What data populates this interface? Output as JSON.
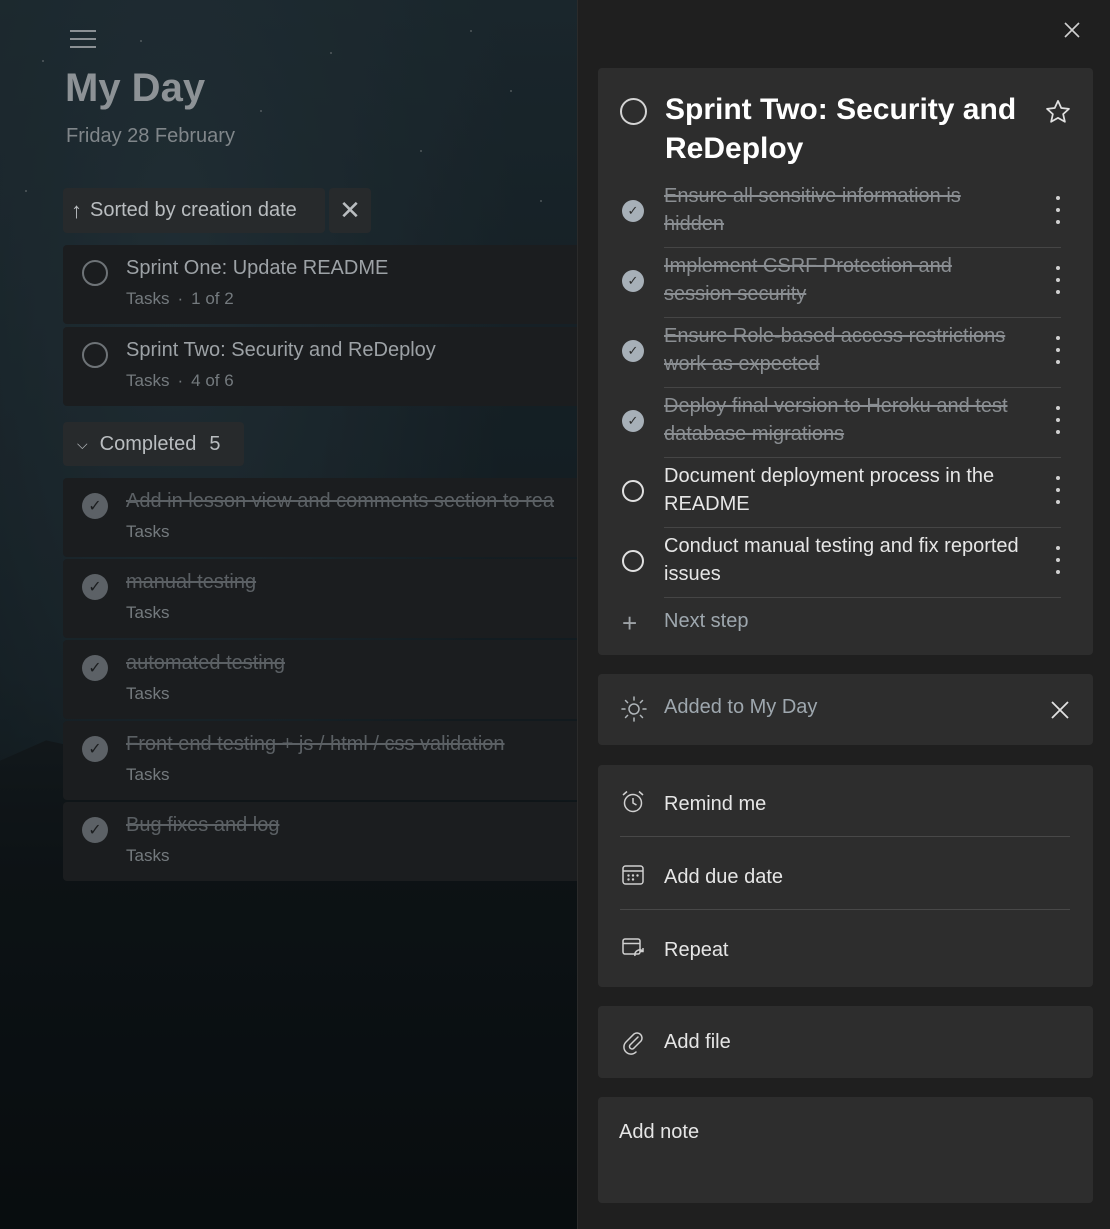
{
  "list": {
    "title": "My Day",
    "date": "Friday 28 February",
    "sort_label": "Sorted by creation date",
    "tasks": [
      {
        "title": "Sprint One: Update README",
        "list": "Tasks",
        "progress": "1 of 2"
      },
      {
        "title": "Sprint Two: Security and ReDeploy",
        "list": "Tasks",
        "progress": "4 of 6"
      }
    ],
    "completed_label": "Completed",
    "completed_count": "5",
    "completed": [
      {
        "title": "Add in lesson view and  comments section to rea",
        "list": "Tasks"
      },
      {
        "title": "manual testing",
        "list": "Tasks"
      },
      {
        "title": "automated testing",
        "list": "Tasks"
      },
      {
        "title": "Front end testing + js / html / css validation",
        "list": "Tasks"
      },
      {
        "title": "Bug fixes and log",
        "list": "Tasks"
      }
    ]
  },
  "detail": {
    "title": "Sprint Two: Security and ReDeploy",
    "steps": [
      {
        "text": "Ensure all sensitive information is hidden",
        "done": true
      },
      {
        "text": "Implement CSRF Protection and session security",
        "done": true
      },
      {
        "text": "Ensure Role-based access restrictions work as expected",
        "done": true
      },
      {
        "text": "Deploy final version to Heroku and test database migrations",
        "done": true
      },
      {
        "text": "Document deployment process in the README",
        "done": false
      },
      {
        "text": "Conduct manual testing and fix reported issues",
        "done": false
      }
    ],
    "next_step": "Next step",
    "my_day": "Added to My Day",
    "remind": "Remind me",
    "due": "Add due date",
    "repeat": "Repeat",
    "file": "Add file",
    "note": "Add note"
  },
  "icons": {
    "menu": "hamburger-icon",
    "sort": "arrow-up-icon",
    "close": "close-icon",
    "star": "star-icon",
    "sun": "sun-icon",
    "alarm": "alarm-clock-icon",
    "calendar": "calendar-icon",
    "repeat": "repeat-icon",
    "attach": "paperclip-icon"
  },
  "colors": {
    "panel": "#1f1f1f",
    "card": "#2d2d2d",
    "accent_muted": "#9ea7ae"
  }
}
